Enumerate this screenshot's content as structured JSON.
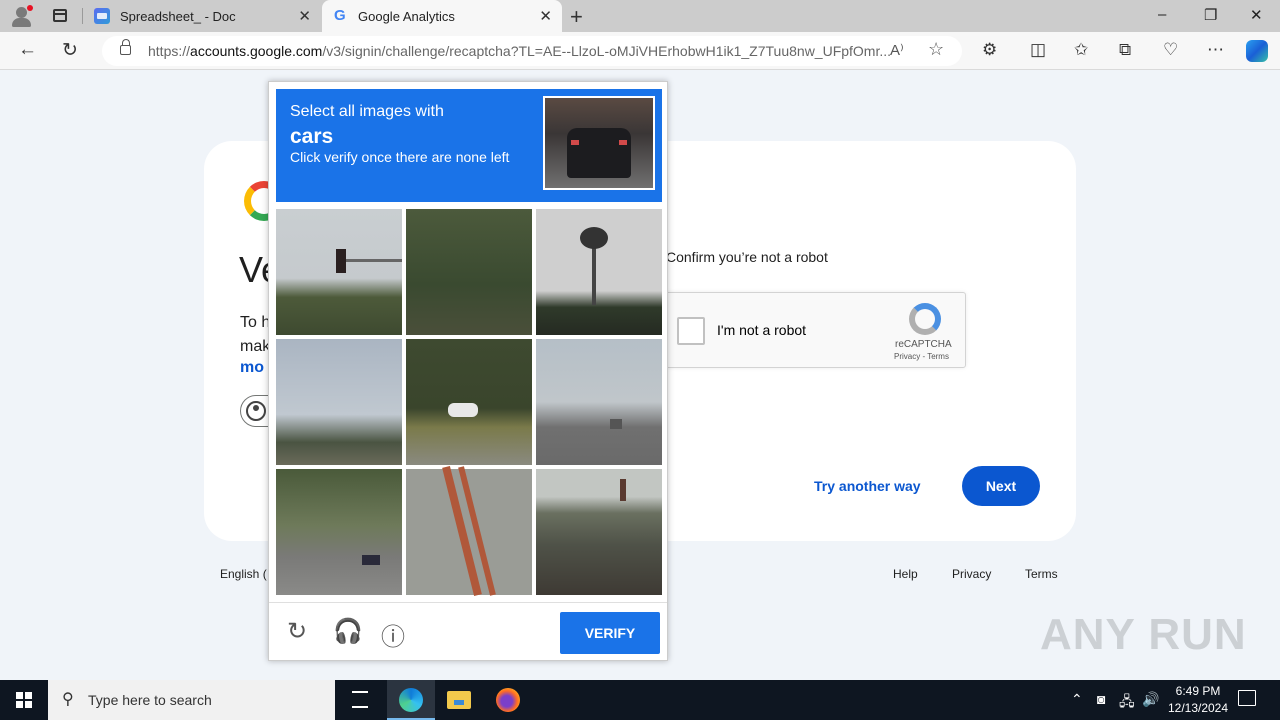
{
  "browser": {
    "tabs": [
      {
        "label": "Spreadsheet_ - Doc",
        "active": false
      },
      {
        "label": "Google Analytics",
        "active": true
      }
    ],
    "new_tab_icon": "plus-icon",
    "window_controls": {
      "minimize": "–",
      "restore": "❐",
      "close": "✕"
    },
    "url": {
      "scheme": "https://",
      "host": "accounts.google.com",
      "path": "/v3/signin/challenge/recaptcha?TL=AE--LlzoL-oMJiVHErhobwH1ik1_Z7Tuu8nw_UFpfOmr..."
    },
    "toolbar_icons": [
      "extensions-icon",
      "split-screen-icon",
      "favorites-icon",
      "collections-icon",
      "browser-essentials-icon",
      "more-icon",
      "copilot-icon"
    ]
  },
  "signin": {
    "heading_partial": "Ve",
    "desc_partial_line1": "To h",
    "desc_partial_line2": "mak",
    "more_partial": "mo",
    "confirm_text": "Confirm you’re not a robot",
    "recaptcha_checkbox": {
      "label": "I'm not a robot",
      "checked": false,
      "brand": "reCAPTCHA",
      "links": "Privacy - Terms"
    },
    "try_another_way": "Try another way",
    "next_label": "Next",
    "footer": {
      "language_partial": "English (",
      "links": [
        "Help",
        "Privacy",
        "Terms"
      ]
    }
  },
  "challenge": {
    "line1": "Select all images with",
    "target": "cars",
    "line3": "Click verify once there are none left",
    "tiles": [
      {
        "description": "traffic light and trees",
        "selected": false
      },
      {
        "description": "ivy-covered building",
        "selected": false
      },
      {
        "description": "palm tree against sky",
        "selected": false
      },
      {
        "description": "row of palm trees",
        "selected": false
      },
      {
        "description": "white car by trees",
        "selected": false
      },
      {
        "description": "road with car",
        "selected": false
      },
      {
        "description": "residential street with parked cars",
        "selected": false
      },
      {
        "description": "ladder against wall",
        "selected": false
      },
      {
        "description": "house roof with chimney",
        "selected": false
      }
    ],
    "footer_icons": [
      "reload-icon",
      "audio-headphones-icon",
      "info-icon"
    ],
    "verify_label": "VERIFY"
  },
  "watermark": "ANY RUN",
  "taskbar": {
    "search_placeholder": "Type here to search",
    "time": "6:49 PM",
    "date": "12/13/2024"
  }
}
